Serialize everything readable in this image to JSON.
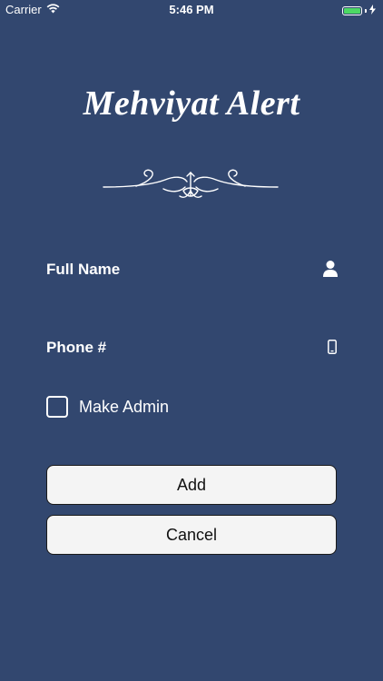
{
  "status_bar": {
    "carrier": "Carrier",
    "time": "5:46 PM",
    "battery_color": "#4cd964"
  },
  "app": {
    "title": "Mehviyat Alert",
    "background_color": "#32476f"
  },
  "form": {
    "full_name": {
      "label": "Full Name",
      "icon": "user-icon"
    },
    "phone": {
      "label": "Phone #",
      "icon": "mobile-phone-icon"
    },
    "make_admin": {
      "label": "Make Admin",
      "checked": false
    }
  },
  "buttons": {
    "add_label": "Add",
    "cancel_label": "Cancel"
  }
}
